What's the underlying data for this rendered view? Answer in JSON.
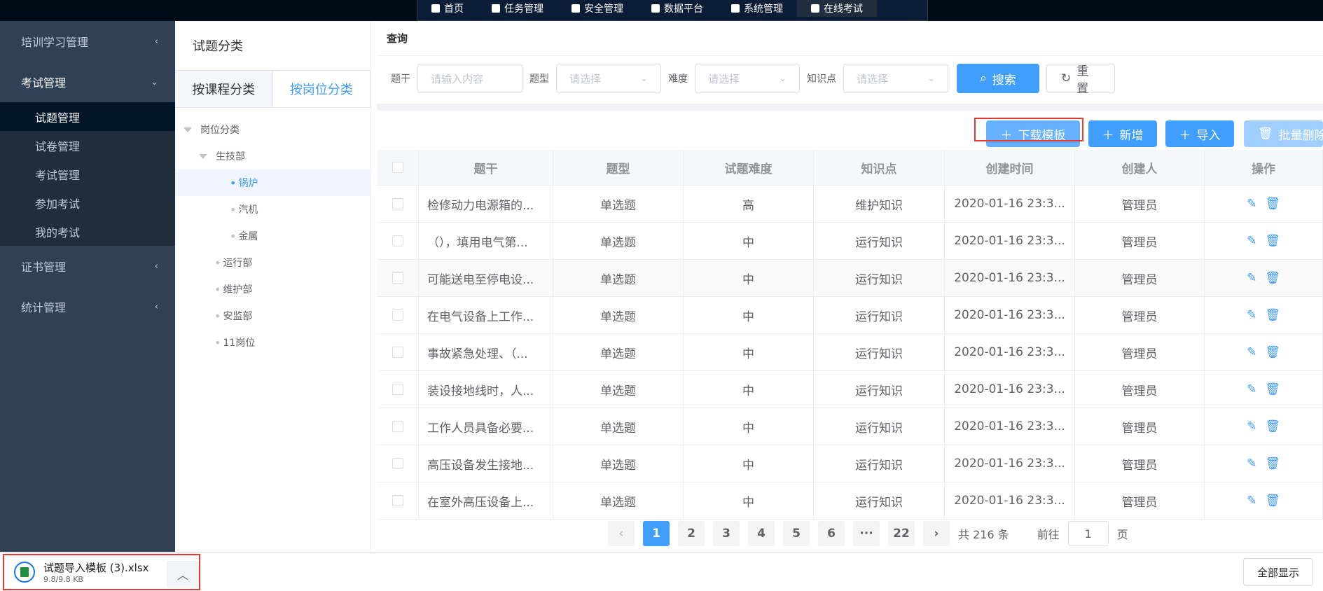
{
  "topnav": {
    "items": [
      {
        "label": "首页",
        "icon": "home-icon"
      },
      {
        "label": "任务管理",
        "icon": "task-icon"
      },
      {
        "label": "安全管理",
        "icon": "shield-icon"
      },
      {
        "label": "数据平台",
        "icon": "database-icon"
      },
      {
        "label": "系统管理",
        "icon": "gear-icon"
      },
      {
        "label": "在线考试",
        "icon": "exam-icon"
      }
    ],
    "active_index": 5
  },
  "sidebar": {
    "groups": [
      {
        "label": "培训学习管理",
        "open": false
      },
      {
        "label": "考试管理",
        "open": true
      },
      {
        "label": "证书管理",
        "open": false
      },
      {
        "label": "统计管理",
        "open": false
      }
    ],
    "exam_submenu": [
      "试题管理",
      "试卷管理",
      "考试管理",
      "参加考试",
      "我的考试"
    ],
    "active_sub": "试题管理"
  },
  "category": {
    "title": "试题分类",
    "tabs": [
      "按课程分类",
      "按岗位分类"
    ],
    "active_tab": 1,
    "tree": [
      {
        "label": "岗位分类",
        "level": 0,
        "type": "branch"
      },
      {
        "label": "生技部",
        "level": 1,
        "type": "branch"
      },
      {
        "label": "锅炉",
        "level": 2,
        "type": "leaf",
        "selected": true
      },
      {
        "label": "汽机",
        "level": 2,
        "type": "leaf"
      },
      {
        "label": "金属",
        "level": 2,
        "type": "leaf"
      },
      {
        "label": "运行部",
        "level": 1,
        "type": "leaf"
      },
      {
        "label": "维护部",
        "level": 1,
        "type": "leaf"
      },
      {
        "label": "安监部",
        "level": 1,
        "type": "leaf"
      },
      {
        "label": "11岗位",
        "level": 1,
        "type": "leaf"
      }
    ]
  },
  "query": {
    "title": "查询",
    "fields": [
      {
        "label": "题干",
        "placeholder": "请输入内容",
        "type": "input"
      },
      {
        "label": "题型",
        "placeholder": "请选择",
        "type": "select"
      },
      {
        "label": "难度",
        "placeholder": "请选择",
        "type": "select"
      },
      {
        "label": "知识点",
        "placeholder": "请选择",
        "type": "select"
      }
    ],
    "search_label": "搜索",
    "reset_label": "重置"
  },
  "toolbar": {
    "download_template": "下载模板",
    "add": "新增",
    "import": "导入",
    "batch_delete": "批量删除"
  },
  "table": {
    "columns": [
      "题干",
      "题型",
      "试题难度",
      "知识点",
      "创建时间",
      "创建人",
      "操作"
    ],
    "rows": [
      [
        "检修动力电源箱的...",
        "单选题",
        "高",
        "维护知识",
        "2020-01-16 23:3...",
        "管理员"
      ],
      [
        "（），填用电气第...",
        "单选题",
        "中",
        "运行知识",
        "2020-01-16 23:3...",
        "管理员"
      ],
      [
        "可能送电至停电设...",
        "单选题",
        "中",
        "运行知识",
        "2020-01-16 23:3...",
        "管理员"
      ],
      [
        "在电气设备上工作...",
        "单选题",
        "中",
        "运行知识",
        "2020-01-16 23:3...",
        "管理员"
      ],
      [
        "事故紧急处理、（...",
        "单选题",
        "中",
        "运行知识",
        "2020-01-16 23:3...",
        "管理员"
      ],
      [
        "装设接地线时，人...",
        "单选题",
        "中",
        "运行知识",
        "2020-01-16 23:3...",
        "管理员"
      ],
      [
        "工作人员具备必要...",
        "单选题",
        "中",
        "运行知识",
        "2020-01-16 23:3...",
        "管理员"
      ],
      [
        "高压设备发生接地...",
        "单选题",
        "中",
        "运行知识",
        "2020-01-16 23:3...",
        "管理员"
      ],
      [
        "在室外高压设备上...",
        "单选题",
        "中",
        "运行知识",
        "2020-01-16 23:3...",
        "管理员"
      ]
    ]
  },
  "pagination": {
    "prev": "‹",
    "pages": [
      "1",
      "2",
      "3",
      "4",
      "5",
      "6",
      "···",
      "22"
    ],
    "active": "1",
    "next": "›",
    "total": "共 216 条",
    "goto_prefix": "前往",
    "goto_value": "1",
    "goto_suffix": "页"
  },
  "download_bar": {
    "file_name": "试题导入模板 (3).xlsx",
    "file_size": "9.8/9.8 KB",
    "expand_icon": "chevron-up-icon",
    "show_all": "全部显示"
  },
  "colors": {
    "primary": "#409eff",
    "sidebar_bg": "#304156",
    "highlight": "#e53935"
  }
}
